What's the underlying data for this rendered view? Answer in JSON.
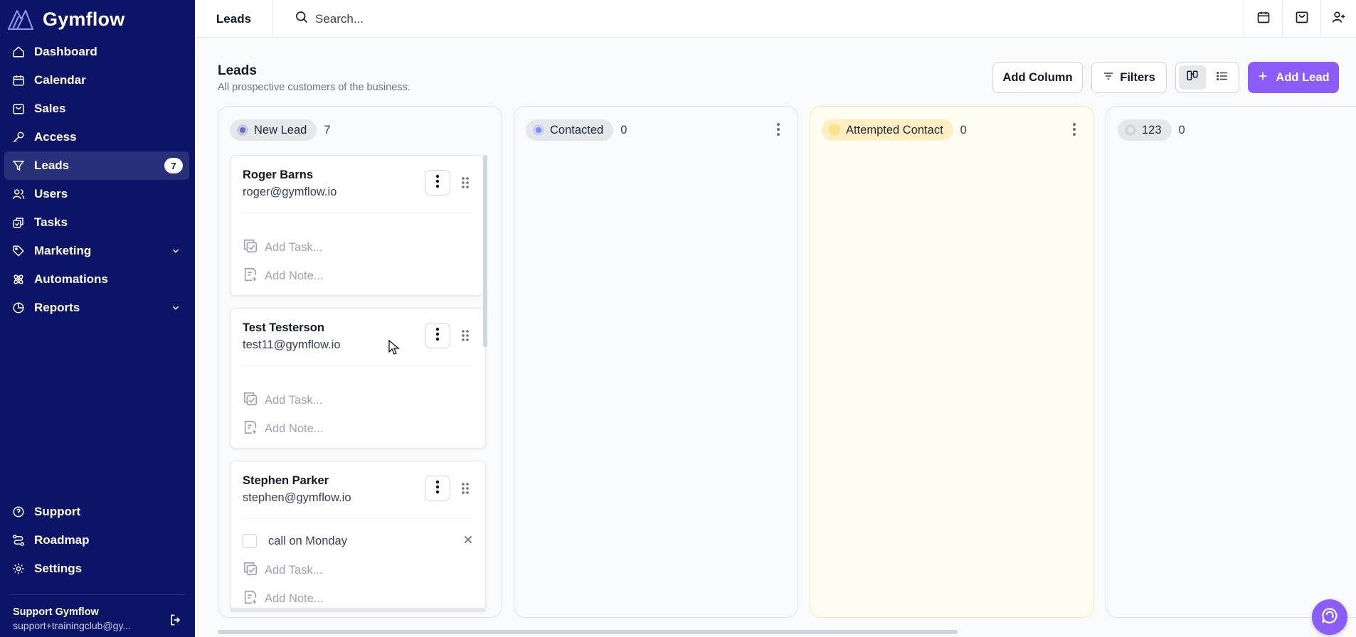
{
  "app": {
    "name": "Gymflow",
    "brand_color": "#0b1467",
    "accent_color": "#8b5cf6"
  },
  "sidebar": {
    "items": [
      {
        "label": "Dashboard",
        "icon": "home-icon"
      },
      {
        "label": "Calendar",
        "icon": "calendar-icon"
      },
      {
        "label": "Sales",
        "icon": "shopping-bag-icon"
      },
      {
        "label": "Access",
        "icon": "key-icon"
      },
      {
        "label": "Leads",
        "icon": "filter-icon",
        "badge": "7",
        "active": true
      },
      {
        "label": "Users",
        "icon": "users-icon"
      },
      {
        "label": "Tasks",
        "icon": "tasks-icon"
      },
      {
        "label": "Marketing",
        "icon": "tag-icon",
        "expandable": true
      },
      {
        "label": "Automations",
        "icon": "atom-icon"
      },
      {
        "label": "Reports",
        "icon": "pie-chart-icon",
        "expandable": true
      }
    ],
    "bottom_items": [
      {
        "label": "Support",
        "icon": "help-circle-icon"
      },
      {
        "label": "Roadmap",
        "icon": "route-icon"
      },
      {
        "label": "Settings",
        "icon": "gear-icon"
      }
    ],
    "user": {
      "name": "Support Gymflow",
      "email": "support+trainingclub@gy..."
    }
  },
  "topbar": {
    "title": "Leads",
    "search_placeholder": "Search..."
  },
  "page": {
    "title": "Leads",
    "subtitle": "All prospective customers of the business.",
    "add_column_label": "Add Column",
    "filters_label": "Filters",
    "add_lead_label": "Add Lead"
  },
  "columns": [
    {
      "label": "New Lead",
      "count": "7",
      "cards": [
        {
          "name": "Roger Barns",
          "email": "roger@gymflow.io",
          "add_task": "Add Task...",
          "add_note": "Add Note..."
        },
        {
          "name": "Test Testerson",
          "email": "test11@gymflow.io",
          "add_task": "Add Task...",
          "add_note": "Add Note..."
        },
        {
          "name": "Stephen Parker",
          "email": "stephen@gymflow.io",
          "task": "call on Monday",
          "add_task": "Add Task...",
          "add_note": "Add Note..."
        }
      ]
    },
    {
      "label": "Contacted",
      "count": "0"
    },
    {
      "label": "Attempted Contact",
      "count": "0"
    },
    {
      "label": "123",
      "count": "0"
    }
  ]
}
